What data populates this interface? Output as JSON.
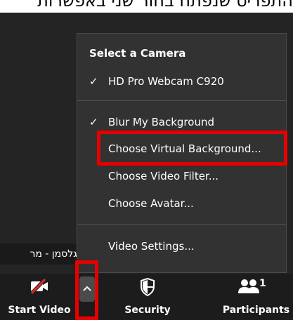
{
  "caption": {
    "text": "התפריט שנפתח בחור שני באפשרות"
  },
  "participant": {
    "name": "נ גלסמן - מר"
  },
  "camera_menu": {
    "heading": "Select a Camera",
    "camera_item": {
      "label": "HD Pro Webcam C920",
      "checked": true
    },
    "background_items": [
      {
        "label": "Blur My Background",
        "checked": true
      },
      {
        "label": "Choose Virtual Background...",
        "checked": false
      },
      {
        "label": "Choose Video Filter...",
        "checked": false
      },
      {
        "label": "Choose Avatar...",
        "checked": false
      }
    ],
    "settings_item": {
      "label": "Video Settings..."
    },
    "check_glyph": "✓"
  },
  "toolbar": {
    "start_video_label": "Start Video",
    "security_label": "Security",
    "participants_label": "Participants",
    "participants_count": "1"
  },
  "colors": {
    "highlight": "#e60000",
    "menu_background": "#323232",
    "toolbar_background": "#1c1c1c",
    "video_mute_slash": "#e02828"
  }
}
